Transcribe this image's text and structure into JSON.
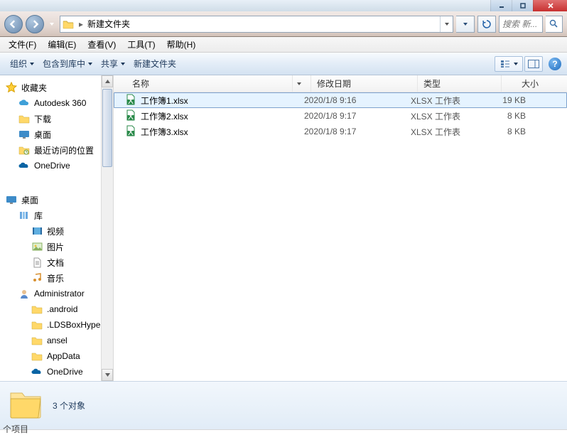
{
  "address": {
    "path": "新建文件夹",
    "search_placeholder": "搜索 新..."
  },
  "menu": {
    "file": "文件(F)",
    "edit": "编辑(E)",
    "view": "查看(V)",
    "tools": "工具(T)",
    "help": "帮助(H)"
  },
  "toolbar": {
    "organize": "组织",
    "include": "包含到库中",
    "share": "共享",
    "newfolder": "新建文件夹"
  },
  "columns": {
    "name": "名称",
    "date": "修改日期",
    "type": "类型",
    "size": "大小"
  },
  "sidebar": {
    "favorites": "收藏夹",
    "fav_items": [
      "Autodesk 360",
      "下载",
      "桌面",
      "最近访问的位置",
      "OneDrive"
    ],
    "desktop": "桌面",
    "libs": "库",
    "lib_items": [
      "视频",
      "图片",
      "文档",
      "音乐"
    ],
    "user": "Administrator",
    "user_items": [
      ".android",
      ".LDSBoxHyperv",
      "ansel",
      "AppData",
      "OneDrive"
    ]
  },
  "files": [
    {
      "name": "工作簿1.xlsx",
      "date": "2020/1/8 9:16",
      "type": "XLSX 工作表",
      "size": "19 KB"
    },
    {
      "name": "工作簿2.xlsx",
      "date": "2020/1/8 9:17",
      "type": "XLSX 工作表",
      "size": "8 KB"
    },
    {
      "name": "工作簿3.xlsx",
      "date": "2020/1/8 9:17",
      "type": "XLSX 工作表",
      "size": "8 KB"
    }
  ],
  "details": {
    "count": "3 个对象"
  },
  "bottom_label": "个项目"
}
